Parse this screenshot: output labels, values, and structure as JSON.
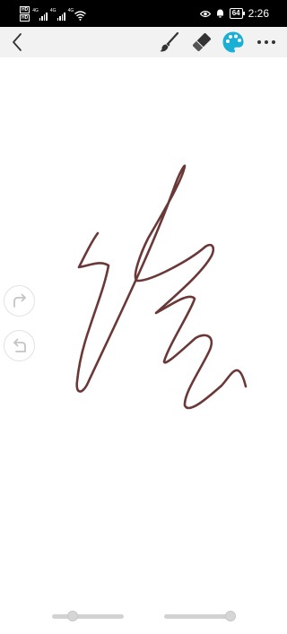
{
  "status_bar": {
    "hd_label_1": "HD",
    "hd_label_2": "HD",
    "net_label_1": "4G",
    "net_label_2": "4G",
    "net_label_3": "4G",
    "battery_level": "64",
    "time": "2:26"
  },
  "toolbar": {
    "back_icon": "chevron-left-icon",
    "brush_icon": "brush-icon",
    "eraser_icon": "eraser-icon",
    "palette_icon": "palette-icon",
    "palette_color": "#1ab0d6",
    "more_icon": "more-horizontal-icon"
  },
  "canvas": {
    "stroke_color": "#6b3838",
    "background": "#ffffff"
  },
  "side_buttons": {
    "redo_icon": "redo-icon",
    "undo_icon": "undo-icon"
  },
  "sliders": {
    "brush_size_fraction": 0.25,
    "opacity_fraction": 1.0
  }
}
